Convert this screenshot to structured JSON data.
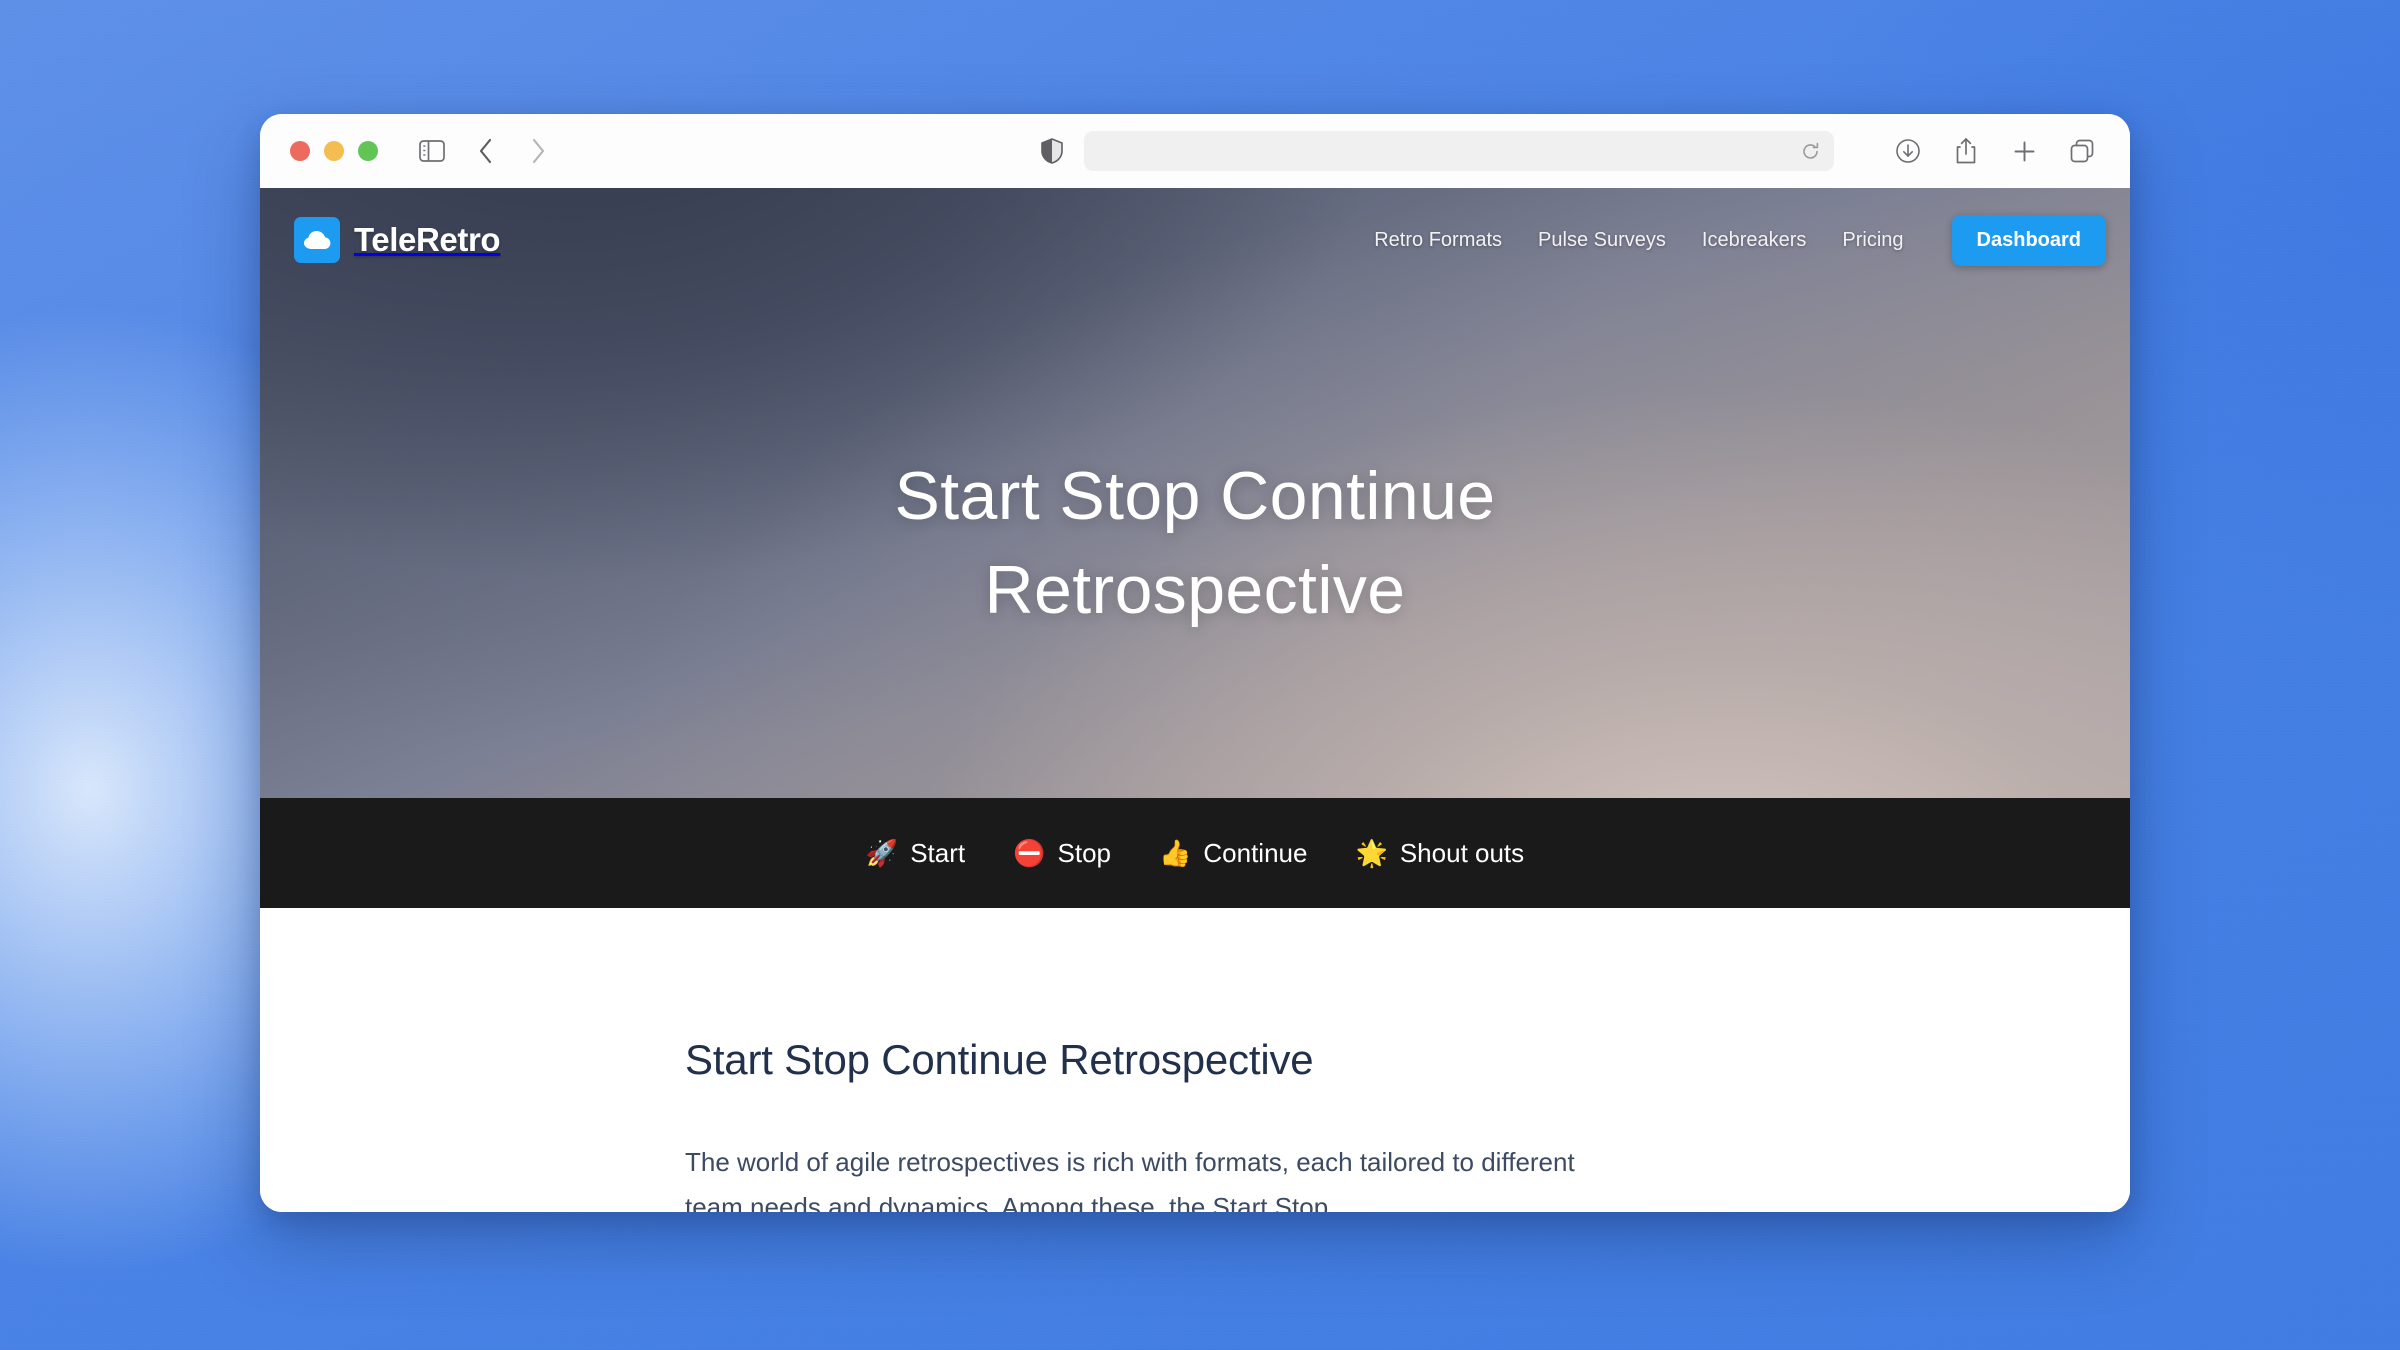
{
  "browser": {
    "traffic_lights": [
      {
        "name": "close",
        "color": "#ed6b5e"
      },
      {
        "name": "minimize",
        "color": "#f4bd4f"
      },
      {
        "name": "maximize",
        "color": "#61c454"
      }
    ],
    "sidebar_toggle_icon": "sidebar-icon",
    "back_icon": "chevron-left-icon",
    "forward_icon": "chevron-right-icon",
    "shield_icon": "privacy-shield-icon",
    "url_value": "",
    "url_placeholder": "",
    "reload_icon": "reload-icon",
    "right_icons": [
      {
        "name": "downloads-icon"
      },
      {
        "name": "share-icon"
      },
      {
        "name": "new-tab-icon"
      },
      {
        "name": "tab-overview-icon"
      }
    ]
  },
  "site": {
    "brand": {
      "name": "TeleRetro",
      "logo_icon": "cloud-icon",
      "logo_bg": "#1d9bf0"
    },
    "nav": [
      {
        "label": "Retro Formats"
      },
      {
        "label": "Pulse Surveys"
      },
      {
        "label": "Icebreakers"
      },
      {
        "label": "Pricing"
      }
    ],
    "cta": {
      "label": "Dashboard",
      "color": "#1d9bf0"
    }
  },
  "hero": {
    "title_line1": "Start Stop Continue",
    "title_line2": "Retrospective"
  },
  "format_bar": {
    "background": "#1a1a1a",
    "items": [
      {
        "emoji": "🚀",
        "icon_name": "rocket-emoji",
        "label": "Start"
      },
      {
        "emoji": "⛔",
        "icon_name": "no-entry-emoji",
        "label": "Stop"
      },
      {
        "emoji": "👍",
        "icon_name": "thumbs-up-emoji",
        "label": "Continue"
      },
      {
        "emoji": "🌟",
        "icon_name": "glowing-star-emoji",
        "label": "Shout outs"
      }
    ]
  },
  "article": {
    "heading": "Start Stop Continue Retrospective",
    "paragraph": "The world of agile retrospectives is rich with formats, each tailored to different team needs and dynamics. Among these, the Start Stop"
  }
}
